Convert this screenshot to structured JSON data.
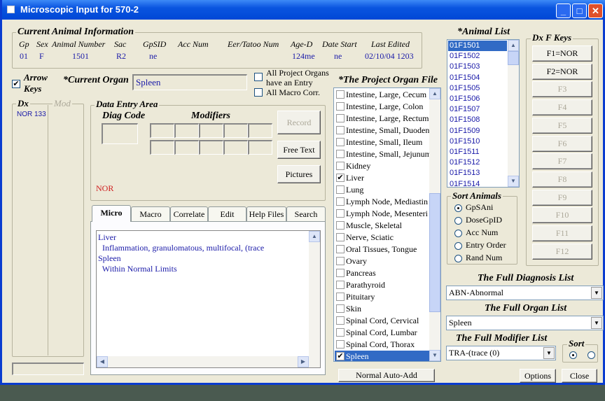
{
  "window": {
    "title": "Microscopic Input for 570-2",
    "accent": "#0a55e0"
  },
  "animal_info": {
    "label": "Current Animal Information",
    "headers": [
      "Gp",
      "Sex",
      "Animal Number",
      "Sac",
      "GpSID",
      "Acc Num",
      "Eer/Tatoo Num",
      "Age-D",
      "Date Start",
      "Last Edited"
    ],
    "values": {
      "gp": "01",
      "sex": "F",
      "animal_number": "1501",
      "sac": "R2",
      "gpsid": "ne",
      "age_d": "124me",
      "date_start": "ne",
      "last_edited": "02/10/04 1203"
    }
  },
  "arrow_keys": {
    "label_1": "Arrow",
    "label_2": "Keys",
    "checked": true
  },
  "current_organ": {
    "label": "*Current Organ",
    "value": "Spleen"
  },
  "options_checks": [
    {
      "label_1": "All Project Organs",
      "label_2": "have an Entry",
      "checked": false
    },
    {
      "label": "All Macro Corr.",
      "checked": false
    }
  ],
  "dx_panel": {
    "dx_label": "Dx",
    "mod_label": "Mod",
    "items": [
      "NOR 133"
    ]
  },
  "data_entry": {
    "label": "Data Entry Area",
    "diag_code": "Diag Code",
    "modifiers": "Modifiers",
    "code_display": "NOR",
    "record": "Record",
    "free_text": "Free Text",
    "pictures": "Pictures"
  },
  "tabs": [
    "Micro",
    "Macro",
    "Correlate",
    "Edit",
    "Help Files",
    "Search"
  ],
  "micro_text": [
    "Liver",
    "  Inflammation, granulomatous, multifocal, (trace",
    "Spleen",
    "  Within Normal Limits"
  ],
  "organ_file": {
    "label": "*The Project Organ File",
    "items": [
      {
        "label": "Intestine, Large, Cecum",
        "checked": false
      },
      {
        "label": "Intestine, Large, Colon",
        "checked": false
      },
      {
        "label": "Intestine, Large, Rectum-",
        "checked": false
      },
      {
        "label": "Intestine, Small, Duoden",
        "checked": false
      },
      {
        "label": "Intestine, Small, Ileum",
        "checked": false
      },
      {
        "label": "Intestine, Small, Jejunum",
        "checked": false
      },
      {
        "label": "Kidney",
        "checked": false
      },
      {
        "label": "Liver",
        "checked": true
      },
      {
        "label": "Lung",
        "checked": false
      },
      {
        "label": "Lymph Node, Mediastin",
        "checked": false
      },
      {
        "label": "Lymph Node, Mesenteri",
        "checked": false
      },
      {
        "label": "Muscle, Skeletal",
        "checked": false
      },
      {
        "label": "Nerve, Sciatic",
        "checked": false
      },
      {
        "label": "Oral Tissues, Tongue",
        "checked": false
      },
      {
        "label": "Ovary",
        "checked": false
      },
      {
        "label": "Pancreas",
        "checked": false
      },
      {
        "label": "Parathyroid",
        "checked": false
      },
      {
        "label": "Pituitary",
        "checked": false
      },
      {
        "label": "Skin",
        "checked": false
      },
      {
        "label": "Spinal Cord, Cervical",
        "checked": false
      },
      {
        "label": "Spinal Cord, Lumbar",
        "checked": false
      },
      {
        "label": "Spinal Cord, Thorax",
        "checked": false
      },
      {
        "label": "Spleen",
        "checked": true,
        "selected": true
      }
    ]
  },
  "normal_auto_add": "Normal Auto-Add",
  "animal_list": {
    "label": "*Animal List",
    "items": [
      "01F1501",
      "01F1502",
      "01F1503",
      "01F1504",
      "01F1505",
      "01F1506",
      "01F1507",
      "01F1508",
      "01F1509",
      "01F1510",
      "01F1511",
      "01F1512",
      "01F1513",
      "01F1514"
    ],
    "selected": "01F1501"
  },
  "sort_animals": {
    "label": "Sort Animals",
    "options": [
      "GpSAni",
      "DoseGpID",
      "Acc Num",
      "Entry Order",
      "Rand Num"
    ],
    "selected": "GpSAni"
  },
  "dx_fkeys": {
    "label": "Dx F Keys",
    "keys": [
      {
        "label": "F1=NOR",
        "enabled": true
      },
      {
        "label": "F2=NOR",
        "enabled": true
      },
      {
        "label": "F3",
        "enabled": false
      },
      {
        "label": "F4",
        "enabled": false
      },
      {
        "label": "F5",
        "enabled": false
      },
      {
        "label": "F6",
        "enabled": false
      },
      {
        "label": "F7",
        "enabled": false
      },
      {
        "label": "F8",
        "enabled": false
      },
      {
        "label": "F9",
        "enabled": false
      },
      {
        "label": "F10",
        "enabled": false
      },
      {
        "label": "F11",
        "enabled": false
      },
      {
        "label": "F12",
        "enabled": false
      }
    ]
  },
  "full_diagnosis": {
    "label": "The Full Diagnosis List",
    "value": "ABN-Abnormal"
  },
  "full_organ": {
    "label": "The Full Organ List",
    "value": "Spleen"
  },
  "full_modifier": {
    "label": "The Full Modifier List",
    "value": "TRA-(trace (0)"
  },
  "sort": {
    "label": "Sort",
    "selected": 0
  },
  "buttons": {
    "options": "Options",
    "close": "Close"
  }
}
